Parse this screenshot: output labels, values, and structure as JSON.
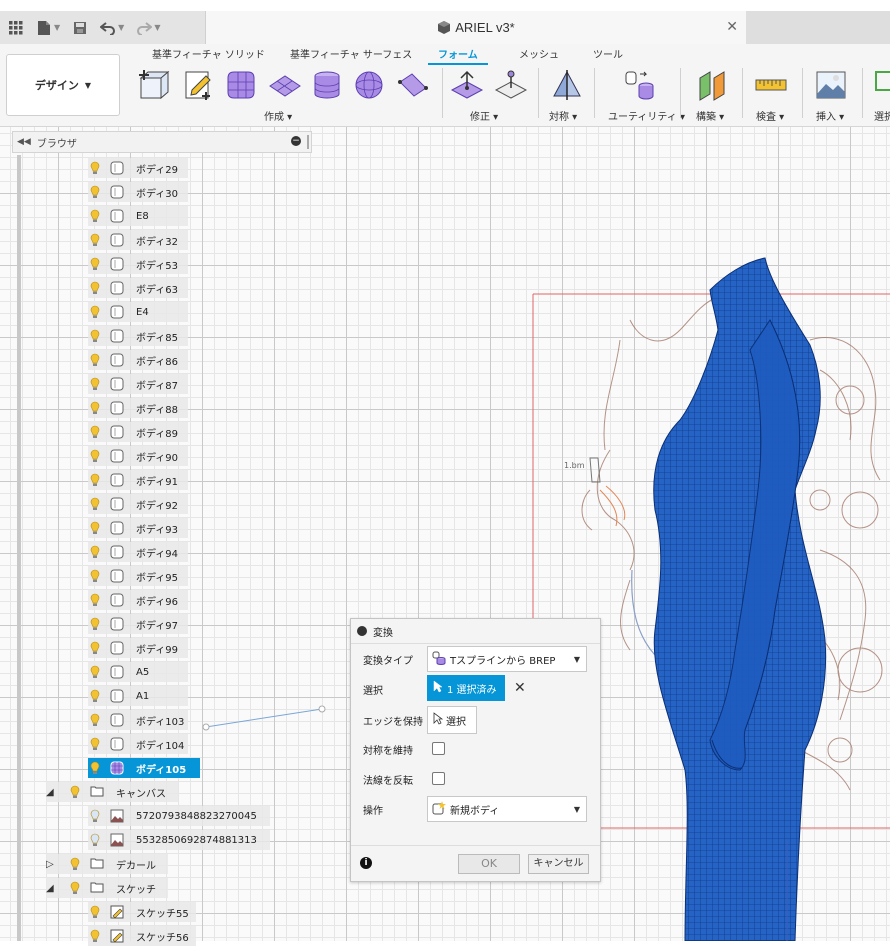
{
  "window": {
    "document_title": "ARIEL v3*"
  },
  "ribbon": {
    "workspace": "デザイン",
    "tabs": [
      {
        "label": "基準フィーチャ ソリッド",
        "active": false
      },
      {
        "label": "基準フィーチャ サーフェス",
        "active": false
      },
      {
        "label": "フォーム",
        "active": true
      },
      {
        "label": "メッシュ",
        "active": false
      },
      {
        "label": "ツール",
        "active": false
      }
    ],
    "groups": {
      "create": "作成 ▾",
      "modify": "修正 ▾",
      "symmetry": "対称 ▾",
      "utility": "ユーティリティ ▾",
      "construct": "構築 ▾",
      "inspect": "検査 ▾",
      "insert": "挿入 ▾",
      "select": "選択"
    }
  },
  "browser": {
    "title": "ブラウザ",
    "bodies": [
      "ボディ29",
      "ボディ30",
      "E8",
      "ボディ32",
      "ボディ53",
      "ボディ63",
      "E4",
      "ボディ85",
      "ボディ86",
      "ボディ87",
      "ボディ88",
      "ボディ89",
      "ボディ90",
      "ボディ91",
      "ボディ92",
      "ボディ93",
      "ボディ94",
      "ボディ95",
      "ボディ96",
      "ボディ97",
      "ボディ99",
      "A5",
      "A1",
      "ボディ103",
      "ボディ104"
    ],
    "selected_body": "ボディ105",
    "canvas_folder": "キャンバス",
    "canvas_items": [
      "5720793848823270045",
      "5532850692874881313"
    ],
    "decal_folder": "デカール",
    "sketch_folder": "スケッチ",
    "sketch_items": [
      "スケッチ55",
      "スケッチ56"
    ]
  },
  "dialog": {
    "title": "変換",
    "convert_type_label": "変換タイプ",
    "convert_type_value": "Tスプラインから BREP",
    "selection_label": "選択",
    "selection_value": "1 選択済み",
    "keep_edges_label": "エッジを保持",
    "keep_edges_button": "選択",
    "keep_symmetry_label": "対称を維持",
    "flip_normals_label": "法線を反転",
    "operation_label": "操作",
    "operation_value": "新規ボディ",
    "ok": "OK",
    "cancel": "キャンセル"
  },
  "colors": {
    "accent": "#0696d7",
    "body_blue": "#1f5fbf"
  }
}
